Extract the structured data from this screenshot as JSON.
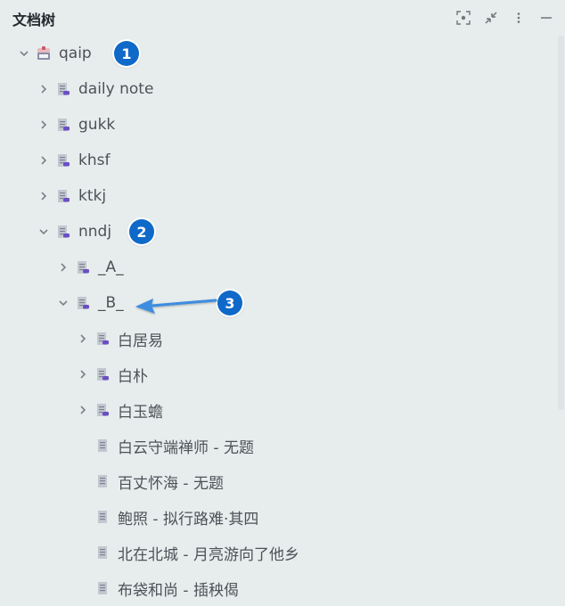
{
  "panel": {
    "title": "文档树",
    "header_icons": [
      "focus-icon",
      "collapse-icon",
      "more-icon",
      "minimize-icon"
    ]
  },
  "tree": [
    {
      "label": "qaip",
      "depth": 0,
      "expanded": true,
      "icon": "notebook-icon",
      "badge": "1"
    },
    {
      "label": "daily note",
      "depth": 1,
      "expanded": false,
      "icon": "doc-folder-icon"
    },
    {
      "label": "gukk",
      "depth": 1,
      "expanded": false,
      "icon": "doc-folder-icon"
    },
    {
      "label": "khsf",
      "depth": 1,
      "expanded": false,
      "icon": "doc-folder-icon"
    },
    {
      "label": "ktkj",
      "depth": 1,
      "expanded": false,
      "icon": "doc-folder-icon"
    },
    {
      "label": "nndj",
      "depth": 1,
      "expanded": true,
      "icon": "doc-folder-icon",
      "badge": "2"
    },
    {
      "label": "_A_",
      "depth": 2,
      "expanded": false,
      "icon": "doc-folder-icon"
    },
    {
      "label": "_B_",
      "depth": 2,
      "expanded": true,
      "icon": "doc-folder-icon",
      "badge": "3"
    },
    {
      "label": "白居易",
      "depth": 3,
      "expanded": false,
      "icon": "doc-folder-icon"
    },
    {
      "label": "白朴",
      "depth": 3,
      "expanded": false,
      "icon": "doc-folder-icon"
    },
    {
      "label": "白玉蟾",
      "depth": 3,
      "expanded": false,
      "icon": "doc-folder-icon"
    },
    {
      "label": "白云守端禅师 - 无题",
      "depth": 3,
      "leaf": true,
      "icon": "doc-icon"
    },
    {
      "label": "百丈怀海 - 无题",
      "depth": 3,
      "leaf": true,
      "icon": "doc-icon"
    },
    {
      "label": "鲍照 - 拟行路难·其四",
      "depth": 3,
      "leaf": true,
      "icon": "doc-icon"
    },
    {
      "label": "北在北城 - 月亮游向了他乡",
      "depth": 3,
      "leaf": true,
      "icon": "doc-icon"
    },
    {
      "label": "布袋和尚 - 插秧偈",
      "depth": 3,
      "leaf": true,
      "icon": "doc-icon"
    }
  ],
  "colors": {
    "background": "#e7eced",
    "badge": "#0f69c9",
    "arrow": "#3d8de0",
    "doc_accent": "#6a4fc4"
  }
}
